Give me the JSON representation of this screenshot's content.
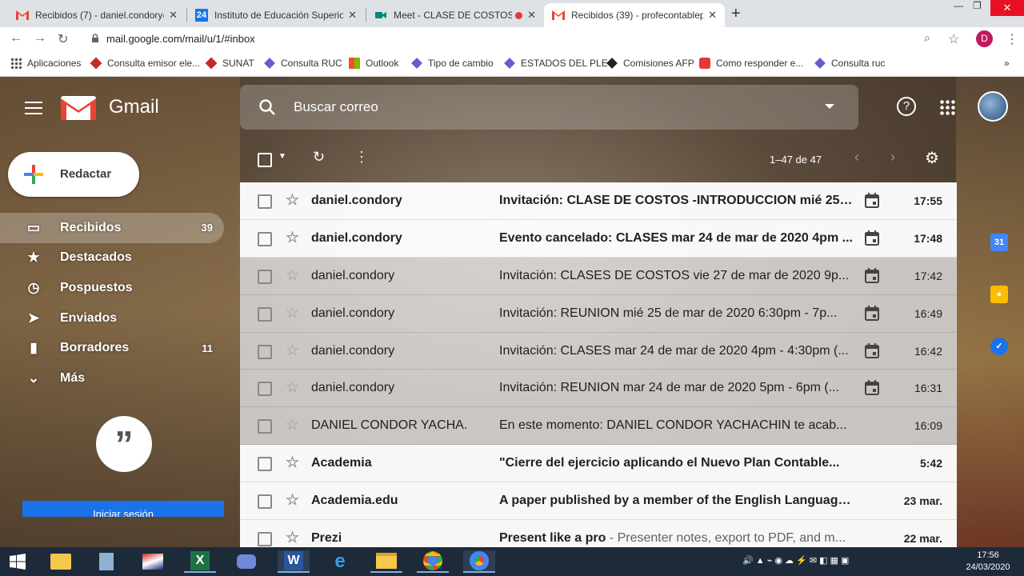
{
  "browser": {
    "tabs": [
      {
        "title": "Recibidos (7) - daniel.condory@",
        "icon": "gmail-icon",
        "active": false
      },
      {
        "title": "Instituto de Educación Superior T",
        "icon": "calendar-24-icon",
        "active": false
      },
      {
        "title": "Meet - CLASE DE COSTOS - ",
        "icon": "meet-icon",
        "active": false
      },
      {
        "title": "Recibidos (39) - profecontablep",
        "icon": "gmail-icon",
        "active": true
      }
    ],
    "calendar_badge": "24",
    "url": "mail.google.com/mail/u/1/#inbox",
    "profile_initial": "D",
    "bookmarks": [
      {
        "label": "Aplicaciones",
        "icon": "apps-grid-icon"
      },
      {
        "label": "Consulta emisor ele...",
        "icon": "sunat-icon"
      },
      {
        "label": "SUNAT",
        "icon": "sunat-icon"
      },
      {
        "label": "Consulta RUC",
        "icon": "diamond-icon"
      },
      {
        "label": "Outlook",
        "icon": "windows-logo-icon"
      },
      {
        "label": "Tipo de cambio",
        "icon": "diamond-icon"
      },
      {
        "label": "ESTADOS DEL PLE",
        "icon": "diamond-icon"
      },
      {
        "label": "Comisiones AFP",
        "icon": "diamond-black-icon"
      },
      {
        "label": "Como responder e...",
        "icon": "youtube-icon"
      },
      {
        "label": "Consulta ruc",
        "icon": "diamond-icon"
      }
    ]
  },
  "gmail": {
    "logo_text": "Gmail",
    "search_placeholder": "Buscar correo",
    "compose_label": "Redactar",
    "nav": [
      {
        "label": "Recibidos",
        "icon": "inbox-icon",
        "count": "39",
        "active": true
      },
      {
        "label": "Destacados",
        "icon": "star-icon",
        "count": "",
        "active": false
      },
      {
        "label": "Pospuestos",
        "icon": "clock-icon",
        "count": "",
        "active": false
      },
      {
        "label": "Enviados",
        "icon": "send-icon",
        "count": "",
        "active": false
      },
      {
        "label": "Borradores",
        "icon": "draft-icon",
        "count": "11",
        "active": false
      },
      {
        "label": "Más",
        "icon": "chevron-down-icon",
        "count": "",
        "active": false
      }
    ],
    "signin_label": "Iniciar sesión",
    "pager_text": "1–47 de 47",
    "emails": [
      {
        "sender": "daniel.condory",
        "subject": "Invitación: CLASE DE COSTOS -INTRODUCCION mié 25 d...",
        "snippet": "",
        "time": "17:55",
        "unread": true,
        "calendar": true
      },
      {
        "sender": "daniel.condory",
        "subject": "Evento cancelado: CLASES mar 24 de mar de 2020 4pm ...",
        "snippet": "",
        "time": "17:48",
        "unread": true,
        "calendar": true
      },
      {
        "sender": "daniel.condory",
        "subject": "Invitación: CLASES DE COSTOS vie 27 de mar de 2020 9p...",
        "snippet": "",
        "time": "17:42",
        "unread": false,
        "calendar": true
      },
      {
        "sender": "daniel.condory",
        "subject": "Invitación: REUNION mié 25 de mar de 2020 6:30pm - 7p...",
        "snippet": "",
        "time": "16:49",
        "unread": false,
        "calendar": true
      },
      {
        "sender": "daniel.condory",
        "subject": "Invitación: CLASES mar 24 de mar de 2020 4pm - 4:30pm (...",
        "snippet": "",
        "time": "16:42",
        "unread": false,
        "calendar": true
      },
      {
        "sender": "daniel.condory",
        "subject": "Invitación: REUNION mar 24 de mar de 2020 5pm - 6pm (...",
        "snippet": "",
        "time": "16:31",
        "unread": false,
        "calendar": true
      },
      {
        "sender": "DANIEL CONDOR YACHA.",
        "subject": "En este momento: DANIEL CONDOR YACHACHIN te acab...",
        "snippet": "",
        "time": "16:09",
        "unread": false,
        "calendar": false
      },
      {
        "sender": "Academia",
        "subject": "\"Cierre del ejercicio aplicando el Nuevo Plan Contable...",
        "snippet": "",
        "time": "5:42",
        "unread": true,
        "calendar": false
      },
      {
        "sender": "Academia.edu",
        "subject": "A paper published by a member of the English Language ...",
        "snippet": "",
        "time": "23 mar.",
        "unread": true,
        "calendar": false
      },
      {
        "sender": "Prezi",
        "subject": "Present like a pro",
        "snippet": " - Presenter notes, export to PDF, and m...",
        "time": "22 mar.",
        "unread": true,
        "calendar": false
      }
    ]
  },
  "taskbar": {
    "apps": [
      "start-icon",
      "folder-icon",
      "calculator-icon",
      "app-icon",
      "excel-icon",
      "discord-icon",
      "word-icon",
      "edge-icon",
      "explorer-icon",
      "chrome-icon",
      "chrome-profile-icon"
    ],
    "time": "17:56",
    "date": "24/03/2020"
  },
  "colors": {
    "gmail_red": "#ea4335",
    "link_blue": "#1a73e8",
    "taskbar": "#1d2a3a"
  }
}
